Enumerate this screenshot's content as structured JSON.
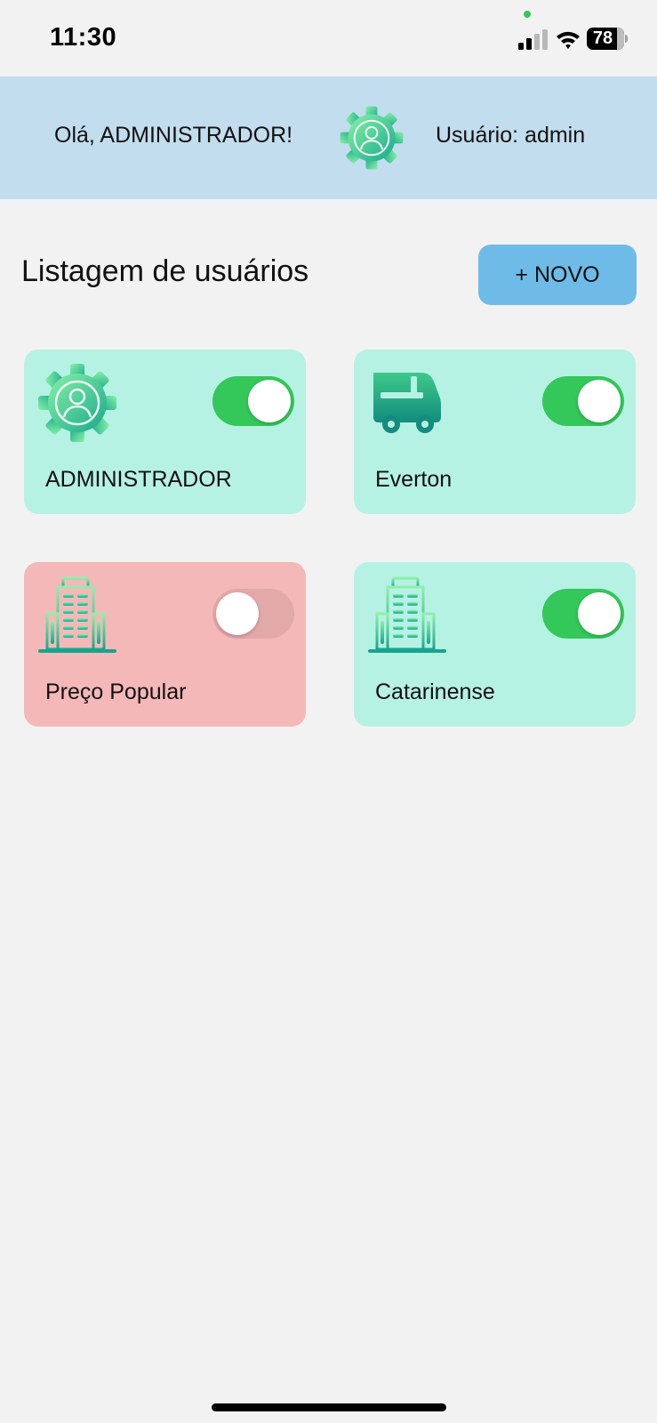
{
  "status_bar": {
    "time": "11:30",
    "battery_level": "78",
    "icons": [
      "signal-icon",
      "wifi-icon",
      "battery-icon"
    ]
  },
  "header": {
    "greeting": "Olá, ADMINISTRADOR!",
    "user_label": "Usuário: admin",
    "logo_icon": "admin-gear-icon",
    "background_color": "#c2ddee"
  },
  "main": {
    "title": "Listagem de usuários",
    "new_button_label": "+ NOVO",
    "new_button_color": "#6fbbe8"
  },
  "cards": [
    {
      "name": "ADMINISTRADOR",
      "icon": "admin-gear-icon",
      "enabled": true
    },
    {
      "name": "Everton",
      "icon": "truck-icon",
      "enabled": true
    },
    {
      "name": "Preço Popular",
      "icon": "building-icon",
      "enabled": false
    },
    {
      "name": "Catarinense",
      "icon": "building-icon",
      "enabled": true
    }
  ],
  "colors": {
    "card_active": "#b6f2e4",
    "card_inactive": "#f5b8b8",
    "toggle_on": "#34c759",
    "icon_gradient_start": "#7ff0a0",
    "icon_gradient_end": "#1fae8e"
  }
}
